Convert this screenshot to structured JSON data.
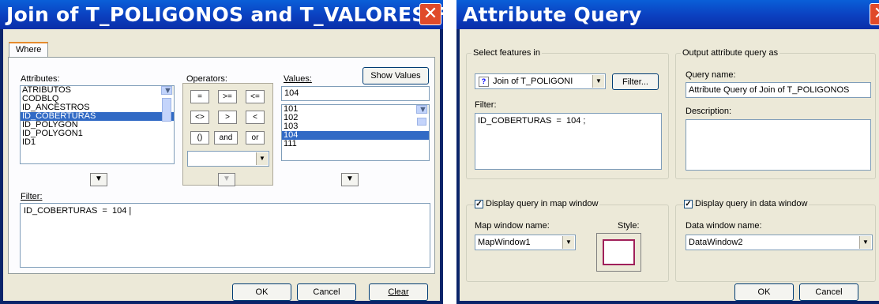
{
  "left": {
    "title": "Join of T_POLIGONOS and T_VALORES Fi...",
    "tab": "Where",
    "attributes_label": "Attributes:",
    "attributes": [
      "ATRIBUTOS",
      "CODBLQ",
      "ID_ANCESTROS",
      "ID_COBERTURAS",
      "ID_POLYGON",
      "ID_POLYGON1",
      "ID1"
    ],
    "operators_label": "Operators:",
    "operators": [
      "=",
      ">=",
      "<=",
      "<>",
      ">",
      "<",
      "()",
      "and",
      "or"
    ],
    "values_label": "Values:",
    "show_values": "Show Values",
    "value_input": "104",
    "values": [
      "101",
      "102",
      "103",
      "104",
      "111"
    ],
    "filter_label": "Filter:",
    "filter": "ID_COBERTURAS  =  104 |",
    "ok": "OK",
    "cancel": "Cancel",
    "clear": "Clear"
  },
  "right": {
    "title": "Attribute Query",
    "select_group": "Select features in",
    "layer": "Join of T_POLIGONI",
    "filter_button": "Filter...",
    "filter_label": "Filter:",
    "filter_text": "ID_COBERTURAS  =  104 ;",
    "output_group": "Output attribute query as",
    "query_name_label": "Query name:",
    "query_name": "Attribute Query of Join of T_POLIGONOS",
    "description_label": "Description:",
    "map_check_label": "Display query in map window",
    "map_window_label": "Map window name:",
    "map_window": "MapWindow1",
    "style_label": "Style:",
    "data_check_label": "Display query in data window",
    "data_window_label": "Data window name:",
    "data_window": "DataWindow2",
    "ok": "OK",
    "cancel": "Cancel"
  }
}
